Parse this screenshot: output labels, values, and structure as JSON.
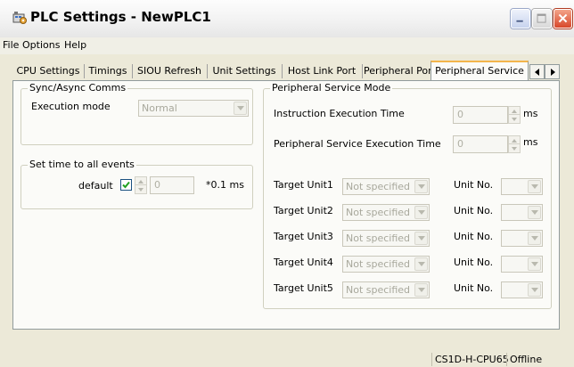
{
  "window": {
    "title": "PLC Settings - NewPLC1",
    "icon": "plc-settings-app-icon"
  },
  "menu": [
    "File",
    "Options",
    "Help"
  ],
  "tabs": [
    {
      "label": "CPU Settings",
      "active": false
    },
    {
      "label": "Timings",
      "active": false
    },
    {
      "label": "SIOU Refresh",
      "active": false
    },
    {
      "label": "Unit Settings",
      "active": false
    },
    {
      "label": "Host Link Port",
      "active": false
    },
    {
      "label": "Peripheral Port",
      "active": false
    },
    {
      "label": "Peripheral Service",
      "active": true
    }
  ],
  "sync": {
    "group_title": "Sync/Async Comms",
    "execution_mode_label": "Execution mode",
    "execution_mode_value": "Normal"
  },
  "events": {
    "group_title": "Set time to all events",
    "default_label": "default",
    "default_checked": true,
    "value": "0",
    "unit": "*0.1 ms"
  },
  "peripheral": {
    "group_title": "Peripheral Service Mode",
    "instruction_label": "Instruction Execution Time",
    "instruction_value": "0",
    "instruction_unit": "ms",
    "service_label": "Peripheral Service Execution Time",
    "service_value": "0",
    "service_unit": "ms",
    "targets": [
      {
        "label": "Target Unit1",
        "value": "Not specified",
        "unit_label": "Unit No.",
        "unit_value": ""
      },
      {
        "label": "Target Unit2",
        "value": "Not specified",
        "unit_label": "Unit No.",
        "unit_value": ""
      },
      {
        "label": "Target Unit3",
        "value": "Not specified",
        "unit_label": "Unit No.",
        "unit_value": ""
      },
      {
        "label": "Target Unit4",
        "value": "Not specified",
        "unit_label": "Unit No.",
        "unit_value": ""
      },
      {
        "label": "Target Unit5",
        "value": "Not specified",
        "unit_label": "Unit No.",
        "unit_value": ""
      }
    ]
  },
  "status": {
    "device": "CS1D-H-CPU65",
    "connection": "Offline"
  }
}
